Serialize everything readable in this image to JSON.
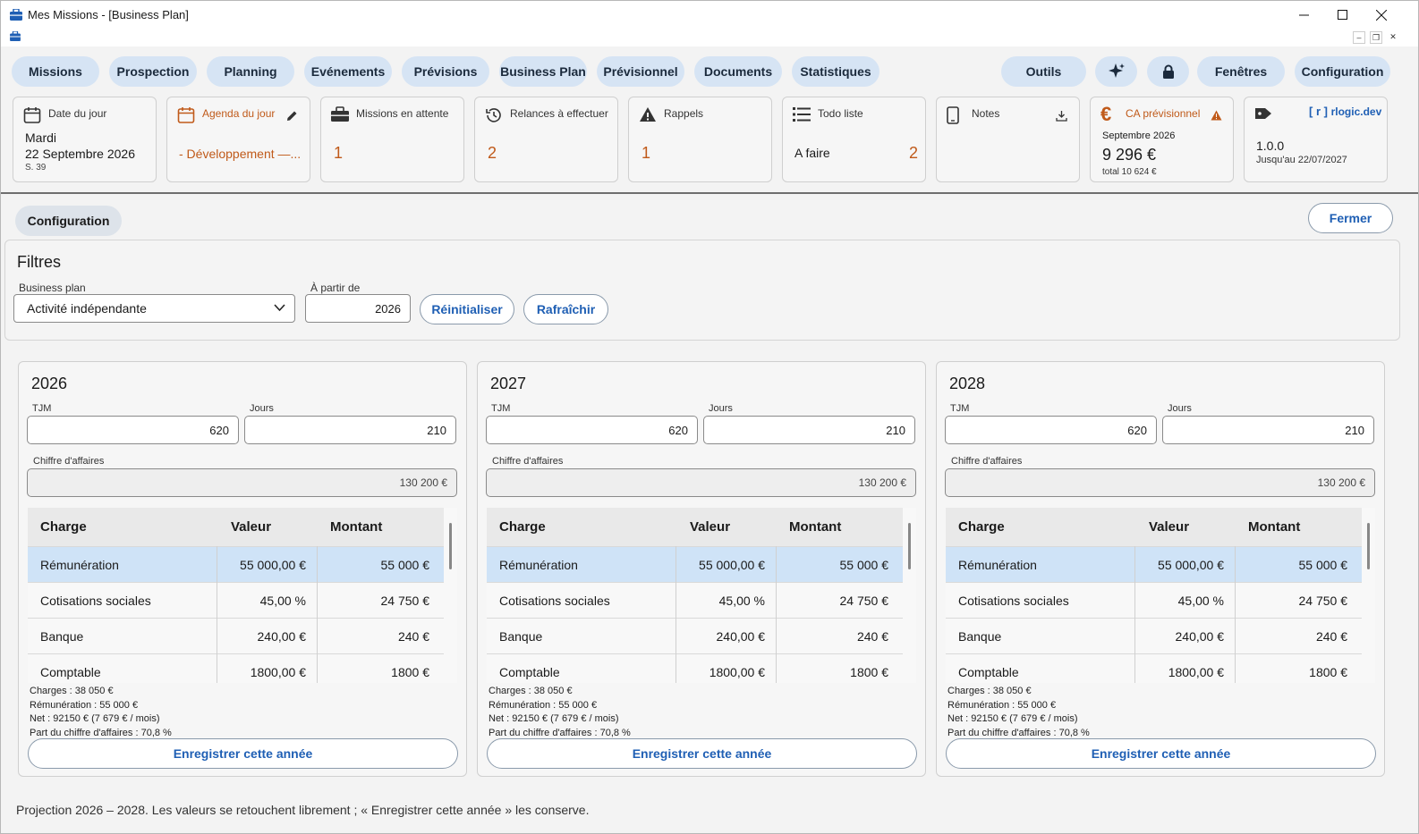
{
  "window": {
    "title": "Mes Missions - [Business Plan]"
  },
  "nav": {
    "left": [
      "Missions",
      "Prospection",
      "Planning",
      "Evénements",
      "Prévisions",
      "Business Plan",
      "Prévisionnel",
      "Documents",
      "Statistiques"
    ],
    "outils": "Outils",
    "fenetres": "Fenêtres",
    "configuration": "Configuration"
  },
  "cards": {
    "date": {
      "label": "Date du jour",
      "day": "Mardi",
      "date": "22 Septembre 2026",
      "week": "S. 39"
    },
    "agenda": {
      "label": "Agenda du jour",
      "value": "- Développement —..."
    },
    "missions": {
      "label": "Missions en attente",
      "value": "1"
    },
    "relances": {
      "label": "Relances à effectuer",
      "value": "2"
    },
    "rappels": {
      "label": "Rappels",
      "value": "1"
    },
    "todo": {
      "label": "Todo liste",
      "item": "A faire",
      "count": "2"
    },
    "notes": {
      "label": "Notes"
    },
    "ca": {
      "label": "CA prévisionnel",
      "month": "Septembre 2026",
      "amount": "9 296 €",
      "total": "total 10 624 €"
    },
    "version": {
      "brand_bracket": "[ r ]",
      "brand": "rlogic.dev",
      "version": "1.0.0",
      "until": "Jusqu'au 22/07/2027"
    }
  },
  "toolbar": {
    "config_label": "Configuration",
    "close_label": "Fermer"
  },
  "filters": {
    "title": "Filtres",
    "bp_label": "Business plan",
    "bp_value": "Activité indépendante",
    "from_label": "À partir de",
    "from_value": "2026",
    "reset_label": "Réinitialiser",
    "refresh_label": "Rafraîchir"
  },
  "labels": {
    "tjm": "TJM",
    "jours": "Jours",
    "ca": "Chiffre d'affaires",
    "charge": "Charge",
    "valeur": "Valeur",
    "montant": "Montant",
    "save": "Enregistrer cette année"
  },
  "years": [
    {
      "year": "2026",
      "tjm": "620",
      "jours": "210",
      "ca": "130 200 €",
      "rows": [
        {
          "charge": "Rémunération",
          "valeur": "55 000,00 €",
          "montant": "55 000 €"
        },
        {
          "charge": "Cotisations sociales",
          "valeur": "45,00 %",
          "montant": "24 750 €"
        },
        {
          "charge": "Banque",
          "valeur": "240,00 €",
          "montant": "240 €"
        },
        {
          "charge": "Comptable",
          "valeur": "1800,00 €",
          "montant": "1800 €"
        }
      ],
      "summary": [
        "Charges : 38 050 €",
        "Rémunération : 55 000 €",
        "Net : 92150 €   (7 679 € / mois)",
        "Part du chiffre d'affaires : 70,8 %"
      ]
    },
    {
      "year": "2027",
      "tjm": "620",
      "jours": "210",
      "ca": "130 200 €",
      "rows": [
        {
          "charge": "Rémunération",
          "valeur": "55 000,00 €",
          "montant": "55 000 €"
        },
        {
          "charge": "Cotisations sociales",
          "valeur": "45,00 %",
          "montant": "24 750 €"
        },
        {
          "charge": "Banque",
          "valeur": "240,00 €",
          "montant": "240 €"
        },
        {
          "charge": "Comptable",
          "valeur": "1800,00 €",
          "montant": "1800 €"
        }
      ],
      "summary": [
        "Charges : 38 050 €",
        "Rémunération : 55 000 €",
        "Net : 92150 €   (7 679 € / mois)",
        "Part du chiffre d'affaires : 70,8 %"
      ]
    },
    {
      "year": "2028",
      "tjm": "620",
      "jours": "210",
      "ca": "130 200 €",
      "rows": [
        {
          "charge": "Rémunération",
          "valeur": "55 000,00 €",
          "montant": "55 000 €"
        },
        {
          "charge": "Cotisations sociales",
          "valeur": "45,00 %",
          "montant": "24 750 €"
        },
        {
          "charge": "Banque",
          "valeur": "240,00 €",
          "montant": "240 €"
        },
        {
          "charge": "Comptable",
          "valeur": "1800,00 €",
          "montant": "1800 €"
        }
      ],
      "summary": [
        "Charges : 38 050 €",
        "Rémunération : 55 000 €",
        "Net : 92150 €   (7 679 € / mois)",
        "Part du chiffre d'affaires : 70,8 %"
      ]
    }
  ],
  "footer": "Projection 2026 – 2028. Les valeurs se retouchent librement ; « Enregistrer cette année » les conserve.",
  "colors": {
    "pill": "#d6e4f4",
    "accent": "#1f5fb4",
    "orange": "#c05a1a",
    "selected": "#cfe3f7"
  }
}
